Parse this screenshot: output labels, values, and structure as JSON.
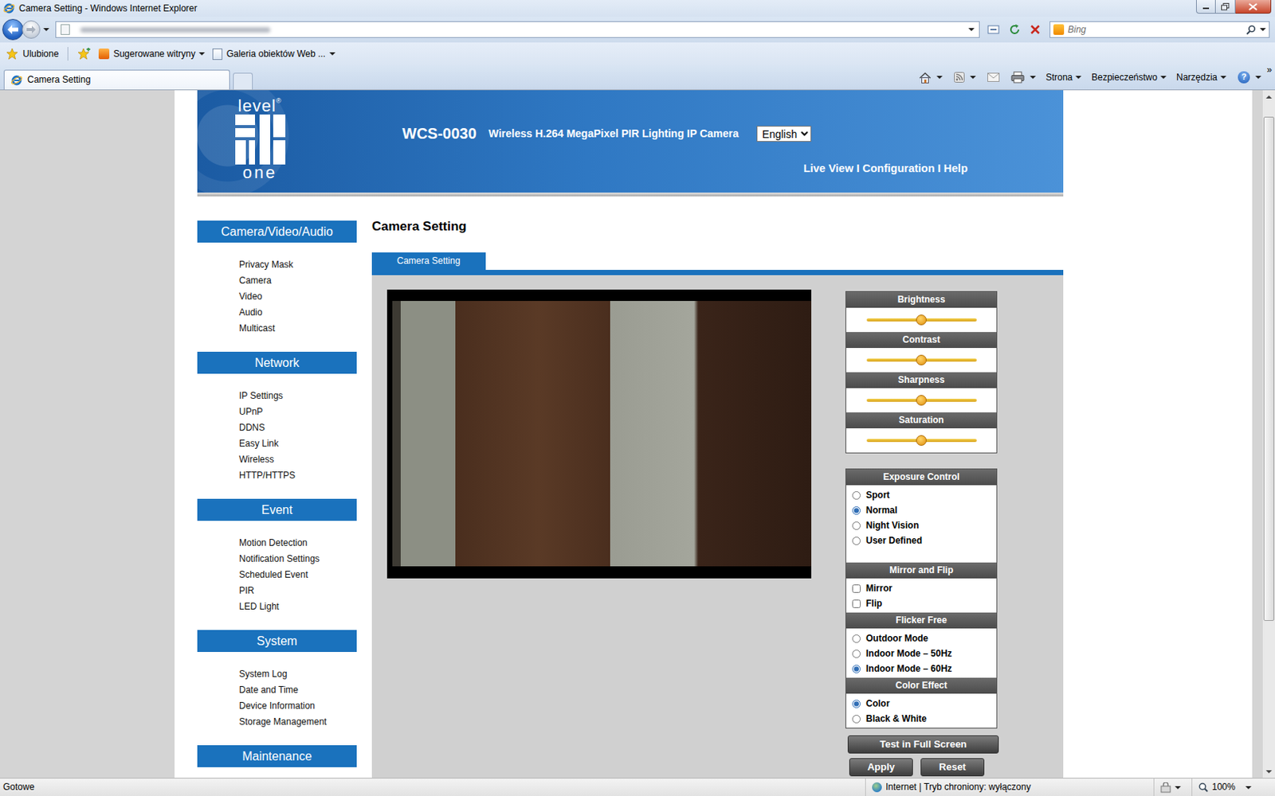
{
  "window": {
    "title": "Camera Setting - Windows Internet Explorer"
  },
  "search": {
    "placeholder": "Bing"
  },
  "favorites_bar": {
    "label": "Ulubione",
    "items": [
      "Sugerowane witryny",
      "Galeria obiektów Web ..."
    ]
  },
  "tabs": [
    {
      "label": "Camera Setting",
      "selected": true
    }
  ],
  "command_bar": {
    "menus": [
      "Strona",
      "Bezpieczeństwo",
      "Narzędzia"
    ],
    "help": "?",
    "overflow": "»"
  },
  "page": {
    "logo": {
      "top": "level",
      "mark": "®",
      "bottom": "one"
    },
    "model": "WCS-0030",
    "product": "Wireless H.264 MegaPixel PIR Lighting IP Camera",
    "language": "English",
    "top_links": [
      "Live View",
      "Configuration",
      "Help"
    ],
    "top_links_separator": "I"
  },
  "sidebar": [
    {
      "title": "Camera/Video/Audio",
      "items": [
        "Privacy Mask",
        "Camera",
        "Video",
        "Audio",
        "Multicast"
      ]
    },
    {
      "title": "Network",
      "items": [
        "IP Settings",
        "UPnP",
        "DDNS",
        "Easy Link",
        "Wireless",
        "HTTP/HTTPS"
      ]
    },
    {
      "title": "Event",
      "items": [
        "Motion Detection",
        "Notification Settings",
        "Scheduled Event",
        "PIR",
        "LED Light"
      ]
    },
    {
      "title": "System",
      "items": [
        "System Log",
        "Date and Time",
        "Device Information",
        "Storage Management"
      ]
    },
    {
      "title": "Maintenance",
      "items": []
    }
  ],
  "main": {
    "title": "Camera Setting",
    "tabs": [
      {
        "label": "Camera Setting",
        "selected": true
      }
    ]
  },
  "sliders": [
    {
      "label": "Brightness",
      "level": 0.5
    },
    {
      "label": "Contrast",
      "level": 0.5
    },
    {
      "label": "Sharpness",
      "level": 0.5
    },
    {
      "label": "Saturation",
      "level": 0.5
    }
  ],
  "options": [
    {
      "title": "Exposure Control",
      "kind": "radio",
      "items": [
        {
          "label": "Sport",
          "selected": false
        },
        {
          "label": "Normal",
          "selected": true
        },
        {
          "label": "Night Vision",
          "selected": false
        },
        {
          "label": "User Defined",
          "selected": false
        }
      ]
    },
    {
      "title": "Mirror and Flip",
      "kind": "checkbox",
      "items": [
        {
          "label": "Mirror",
          "checked": false
        },
        {
          "label": "Flip",
          "checked": false
        }
      ]
    },
    {
      "title": "Flicker Free",
      "kind": "radio",
      "items": [
        {
          "label": "Outdoor Mode",
          "selected": false
        },
        {
          "label": "Indoor Mode – 50Hz",
          "selected": false
        },
        {
          "label": "Indoor Mode – 60Hz",
          "selected": true
        }
      ]
    },
    {
      "title": "Color Effect",
      "kind": "radio",
      "items": [
        {
          "label": "Color",
          "selected": true
        },
        {
          "label": "Black & White",
          "selected": false
        }
      ]
    }
  ],
  "buttons": [
    "Test in Full Screen",
    "Apply",
    "Reset"
  ],
  "status_bar": {
    "text": "Gotowe",
    "zone": "Internet | Tryb chroniony: wyłączony",
    "zoom": "100%"
  }
}
